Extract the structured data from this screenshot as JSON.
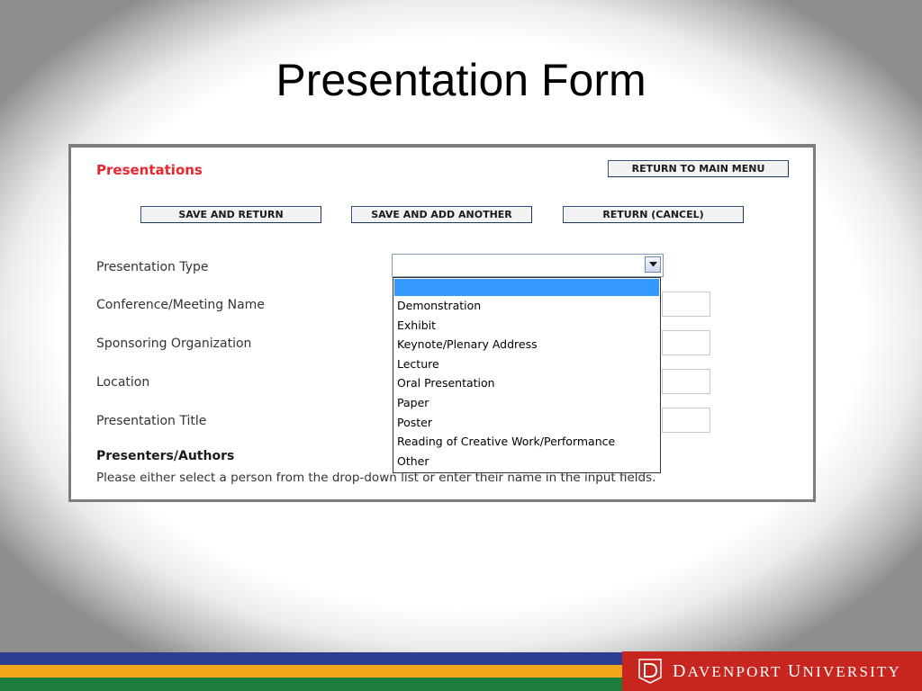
{
  "slide": {
    "title": "Presentation Form"
  },
  "form": {
    "heading": "Presentations",
    "buttons": {
      "return_main": "RETURN TO MAIN MENU",
      "save_return": "SAVE AND RETURN",
      "save_add": "SAVE AND ADD ANOTHER",
      "return_cancel": "RETURN (CANCEL)"
    },
    "labels": {
      "presentation_type": "Presentation Type",
      "conference": "Conference/Meeting Name",
      "sponsor": "Sponsoring Organization",
      "location": "Location",
      "title": "Presentation Title",
      "presenters": "Presenters/Authors"
    },
    "note": "Please either select a person from the drop-down list or enter their name in the input fields.",
    "presentation_type_select": {
      "selected_value": "",
      "options": [
        "",
        "Demonstration",
        "Exhibit",
        "Keynote/Plenary Address",
        "Lecture",
        "Oral Presentation",
        "Paper",
        "Poster",
        "Reading of Creative Work/Performance",
        "Other"
      ]
    }
  },
  "footer": {
    "logo_text_d": "D",
    "logo_text_avenport": "AVENPORT",
    "logo_text_u": "U",
    "logo_text_niversity": "NIVERSITY",
    "stripe_colors": [
      "#2d3d8f",
      "#f2a71b",
      "#1e7d3a"
    ],
    "brand_color": "#c8251f"
  }
}
